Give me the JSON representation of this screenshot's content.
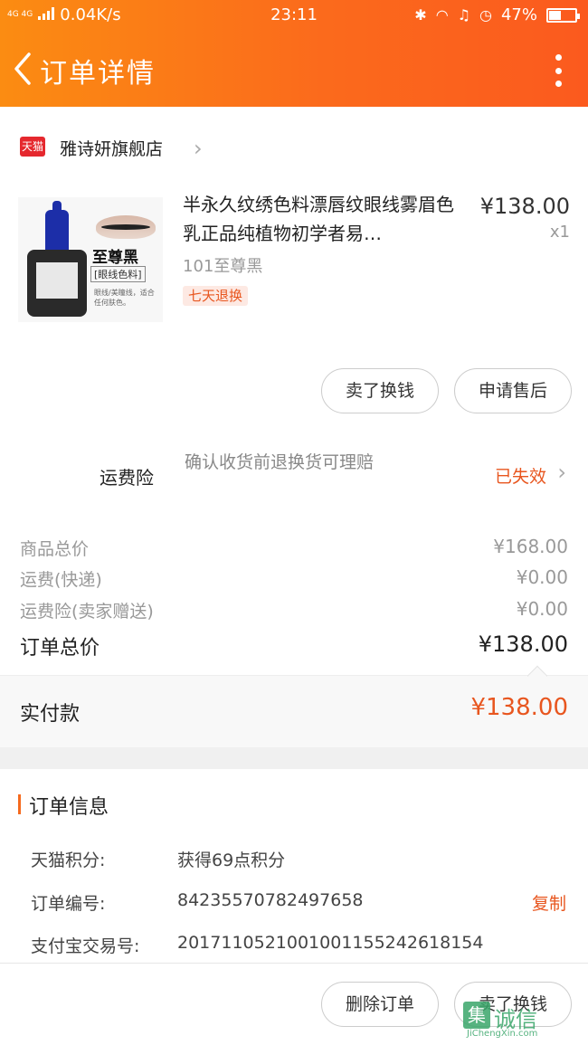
{
  "status_bar": {
    "network": "4G 4G",
    "speed": "0.04K/s",
    "time": "23:11",
    "battery_text": "47%",
    "battery_level": 0.47
  },
  "nav": {
    "title": "订单详情",
    "icons": [
      "back-icon",
      "more-icon"
    ]
  },
  "store": {
    "badge": "天猫",
    "name": "雅诗妍旗舰店"
  },
  "product": {
    "title": "半永久纹绣色料漂唇纹眼线雾眉色乳正品纯植物初学者易…",
    "price": "¥138.00",
    "quantity": "x1",
    "sku": "101至尊黑",
    "badge": "七天退换",
    "image_text": {
      "brand": "至尊黑",
      "sub": "[眼线色料]",
      "note": "眼线/美瞳线，适合任何肤色。"
    }
  },
  "actions": {
    "buy_again": "卖了换钱",
    "after_sale": "申请售后"
  },
  "insurance": {
    "label": "运费险",
    "desc": "确认收货前退换货可理赔",
    "status": "已失效"
  },
  "summary": {
    "goods_total_label": "商品总价",
    "goods_total_value": "¥168.00",
    "shipping_label": "运费(快递)",
    "shipping_value": "¥0.00",
    "insurance_label": "运费险(卖家赠送)",
    "insurance_value": "¥0.00",
    "order_total_label": "订单总价",
    "order_total_value": "¥138.00"
  },
  "paid": {
    "label": "实付款",
    "value": "¥138.00"
  },
  "order_info": {
    "title": "订单信息",
    "points_label": "天猫积分:",
    "points_value": "获得69点积分",
    "order_no_label": "订单编号:",
    "order_no_value": "84235570782497658",
    "copy_label": "复制",
    "alipay_label": "支付宝交易号:",
    "alipay_value": "2017110521001001155242618154"
  },
  "bottom": {
    "delete_order": "删除订单",
    "sell": "卖了换钱"
  },
  "watermark": {
    "box": "集",
    "text": "诚信",
    "url": "JiChengXin.com"
  },
  "colors": {
    "header_start": "#fb8c12",
    "header_end": "#fb5a1e",
    "accent": "#e8561f"
  }
}
